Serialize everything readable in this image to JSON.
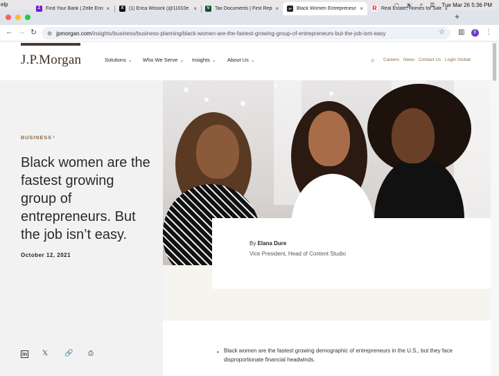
{
  "os_menubar": {
    "app_fragment": "elp",
    "datetime": "Tue Mar 26  5:36 PM"
  },
  "tabs": [
    {
      "title": "Find Your Bank | Zelle Enro",
      "icon": "zelle-icon",
      "color": "#6d1ed4",
      "glyph": "Z"
    },
    {
      "title": "(1) Erica Wissick (@11010e",
      "icon": "x-icon",
      "color": "#111111",
      "glyph": "X"
    },
    {
      "title": "Tax Documents | First Repu",
      "icon": "first-republic-icon",
      "color": "#14532d",
      "glyph": "V"
    },
    {
      "title": "Black Women Entrepreneur",
      "icon": "jpmorgan-icon",
      "color": "#222222",
      "glyph": "JP"
    },
    {
      "title": "Real Estate, Homes for Sale",
      "icon": "realtor-icon",
      "color": "#d92228",
      "glyph": "R"
    }
  ],
  "address_bar": {
    "domain": "jpmorgan.com",
    "path": "/insights/business/business-planning/black-women-are-the-fastest-growing-group-of-entrepreneurs-but-the-job-isnt-easy"
  },
  "profile_initial": "E",
  "site": {
    "logo": "J.P.Morgan",
    "nav": [
      "Solutions",
      "Who We Serve",
      "Insights",
      "About Us"
    ],
    "util": [
      "Careers",
      "News",
      "Contact Us",
      "Login",
      "Global"
    ]
  },
  "article": {
    "category": "BUSINESS",
    "headline": "Black women are the fastest growing group of entrepreneurs. But the job isn’t easy.",
    "date": "October 12, 2021",
    "byline_prefix": "By",
    "author": "Elana Dure",
    "author_role": "Vice President, Head of Content Studio",
    "bullet_1": "Black women are the fastest growing demographic of entrepreneurs in the U.S., but they face disproportionate financial headwinds."
  },
  "share_icons": [
    "linkedin-icon",
    "x-icon",
    "link-icon",
    "print-icon"
  ]
}
